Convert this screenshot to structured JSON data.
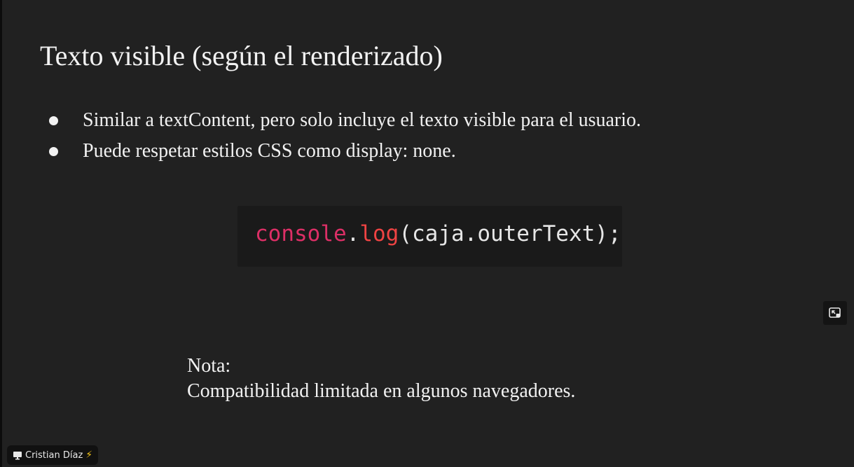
{
  "slide": {
    "title": "Texto visible (según el renderizado)",
    "bullets": [
      {
        "text": "Similar a textContent, pero solo incluye el texto visible para el usuario."
      },
      {
        "text": "Puede respetar estilos CSS como display: none."
      }
    ],
    "code": {
      "object": "console",
      "dot": ".",
      "method": "log",
      "open_paren": "(",
      "argument": "caja.outerText",
      "close": ");"
    },
    "note": {
      "heading": "Nota:",
      "body": "Compatibilidad limitada en algunos navegadores."
    }
  },
  "overlay": {
    "pip_icon": "picture-in-picture-icon",
    "presenter": {
      "icon": "screen-share-icon",
      "name": "Cristian Díaz",
      "emoji": "⚡"
    }
  },
  "colors": {
    "background": "#212121",
    "text": "#f2f2f2",
    "code_background": "#1a1a1a",
    "code_object": "#dc2f66",
    "code_method": "#ef4343",
    "bolt": "#f5c518"
  }
}
